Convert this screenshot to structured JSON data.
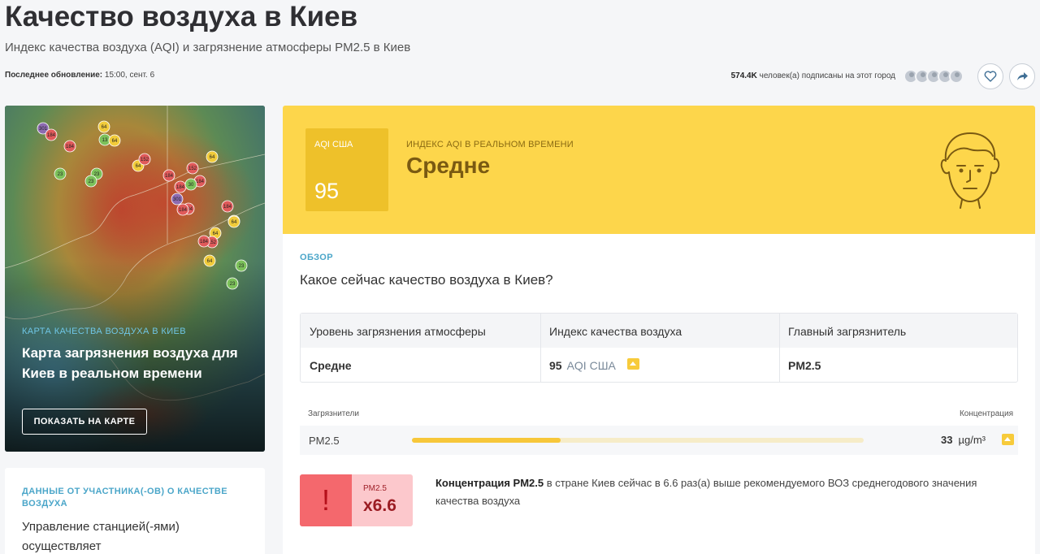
{
  "header": {
    "title": "Качество воздуха в Киев",
    "subtitle": "Индекс качества воздуха (AQI) и загрязнение атмосферы PM2.5 в Киев",
    "last_update_label": "Последнее обновление:",
    "last_update_value": " 15:00, сент. 6",
    "subscribers_count": "574.4K",
    "subscribers_text": " человек(а) подписаны на этот город",
    "favorite_icon": "heart-icon",
    "share_icon": "share-arrow-icon"
  },
  "map_card": {
    "kicker": "КАРТА КАЧЕСТВА ВОЗДУХА В КИЕВ",
    "heading": "Карта загрязнения воздуха для Киев в реальном времени",
    "button_label": "ПОКАЗАТЬ НА КАРТЕ",
    "station_labels": [
      "301",
      "184",
      "184",
      "64",
      "13",
      "64",
      "64",
      "23",
      "152",
      "184",
      "184",
      "23",
      "23",
      "64",
      "152",
      "184",
      "184",
      "64",
      "30",
      "301",
      "184",
      "184",
      "64",
      "64",
      "152",
      "184",
      "64",
      "23",
      "23"
    ]
  },
  "contributors_card": {
    "kicker": "ДАННЫЕ ОТ УЧАСТНИКА(-ОВ) О КАЧЕСТВЕ ВОЗДУХА",
    "text": "Управление станцией(-ями) осуществляет"
  },
  "aqi": {
    "box_label": "AQI США",
    "value": "95",
    "kicker": "ИНДЕКС AQI В РЕАЛЬНОМ ВРЕМЕНИ",
    "level": "Средне",
    "colors": {
      "panel": "#fdd64b",
      "box": "#eec12a"
    }
  },
  "overview": {
    "kicker": "ОБЗОР",
    "question": "Какое сейчас качество воздуха в Киев?",
    "table": {
      "headers": [
        "Уровень загрязнения атмосферы",
        "Индекс качества воздуха",
        "Главный загрязнитель"
      ],
      "row": {
        "level": "Средне",
        "aqi_value": "95",
        "aqi_unit": "AQI США",
        "pollutant": "PM2.5"
      }
    }
  },
  "pollutants": {
    "header_left": "Загрязнители",
    "header_right": "Концентрация",
    "items": [
      {
        "name": "PM2.5",
        "value": "33",
        "unit": "µg/m³",
        "bar_fraction": 0.33
      }
    ]
  },
  "who_comparison": {
    "label": "PM2.5",
    "multiplier": "x6.6",
    "alert_icon": "!",
    "text_bold": "Концентрация PM2.5",
    "text_rest": " в стране Киев сейчас в 6.6 раз(а) выше рекомендуемого ВОЗ среднегодового значения качества воздуха"
  }
}
